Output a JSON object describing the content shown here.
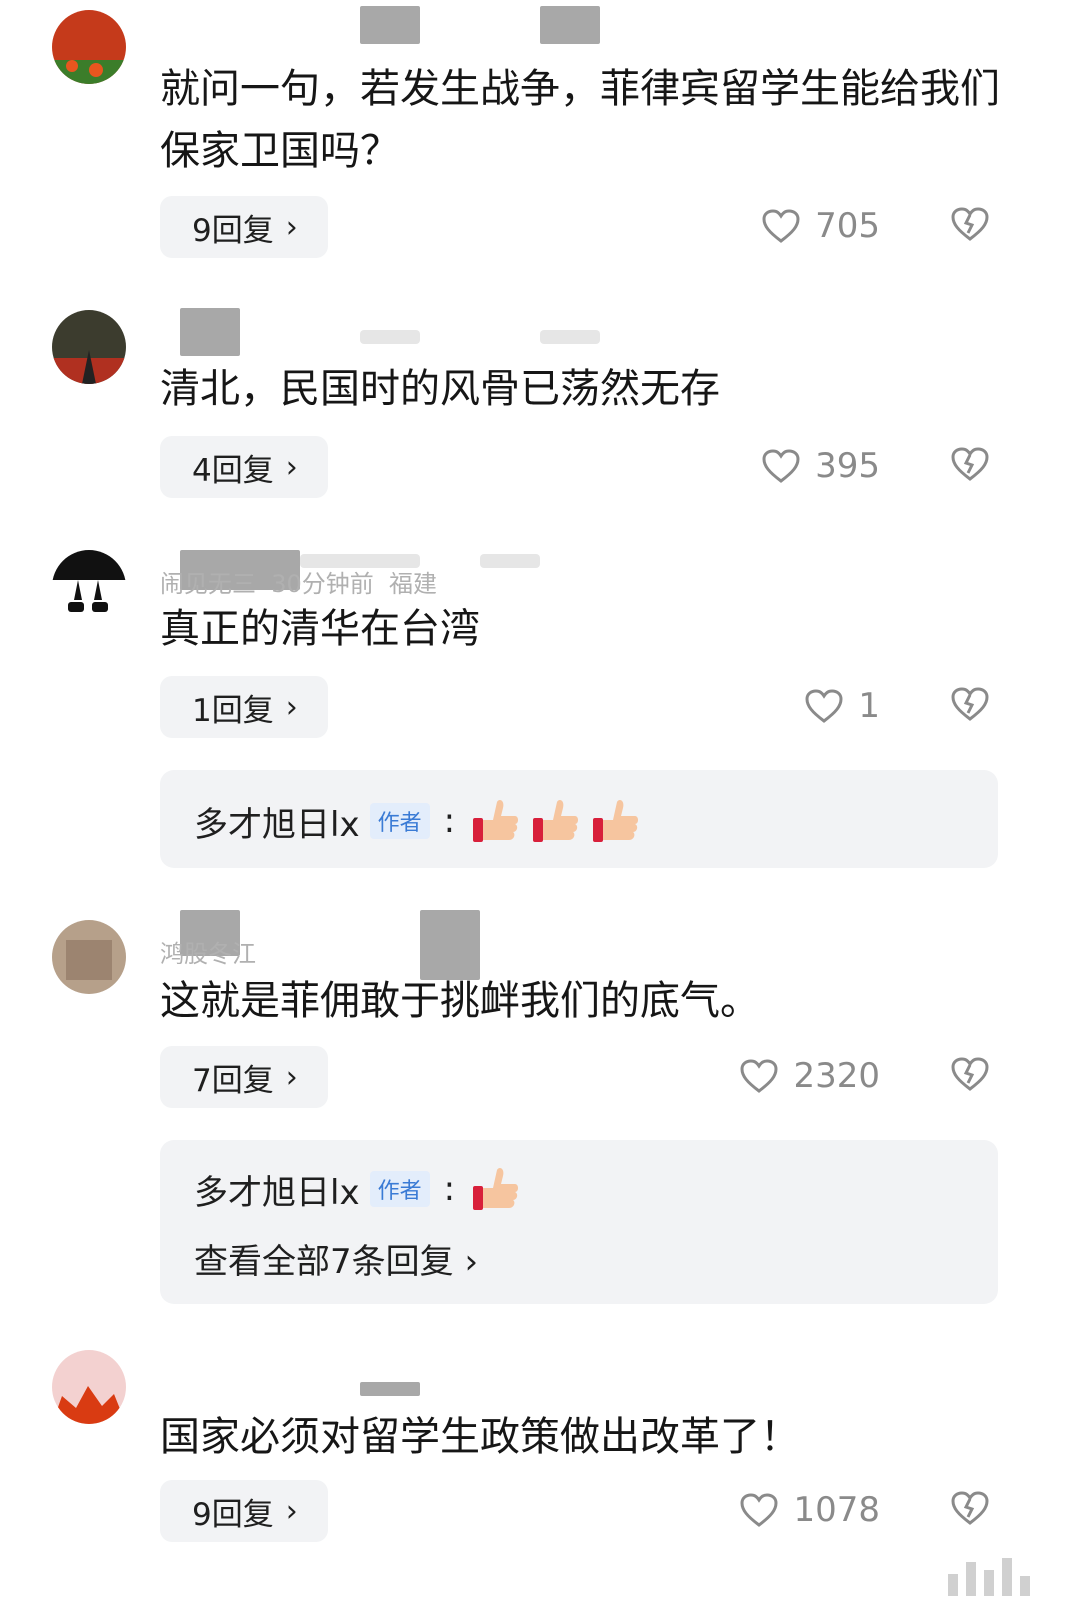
{
  "comments": [
    {
      "text": "就问一句，若发生战争，菲律宾留学生能给我们保家卫国吗？",
      "reply_label": "9回复",
      "likes": "705",
      "avatar_colors": [
        "#c53a1b",
        "#3b7d2a"
      ]
    },
    {
      "text": "清北，民国时的风骨已荡然无存",
      "reply_label": "4回复",
      "likes": "395",
      "avatar_colors": [
        "#3c3c2e",
        "#b03020"
      ]
    },
    {
      "text": "真正的清华在台湾",
      "reply_label": "1回复",
      "likes": "1",
      "meta_visible": "闹见无三  30分钟前  福建",
      "avatar_colors": [
        "#111111",
        "#ffffff"
      ],
      "author_reply": {
        "name": "多才旭日lx",
        "tag": "作者",
        "emoji_count": 3
      }
    },
    {
      "text": "这就是菲佣敢于挑衅我们的底气。",
      "reply_label": "7回复",
      "likes": "2320",
      "meta_visible": "鸿股冬江",
      "avatar_colors": [
        "#b6a08a",
        "#9c8470"
      ],
      "author_reply": {
        "name": "多才旭日lx",
        "tag": "作者",
        "emoji_count": 1,
        "see_all": "查看全部7条回复"
      }
    },
    {
      "text": "国家必须对留学生政策做出改革了！",
      "reply_label": "9回复",
      "likes": "1078",
      "avatar_colors": [
        "#f3d1d0",
        "#d93b12"
      ]
    }
  ],
  "icons": {
    "chevron": "›",
    "like": "heart-outline-icon",
    "dislike": "broken-heart-icon",
    "emoji": "thumbs-up-emoji"
  },
  "colors": {
    "reply_bg": "#f2f3f5",
    "author_tag": "#3a7bd5",
    "count_text": "#8a8a8a"
  }
}
